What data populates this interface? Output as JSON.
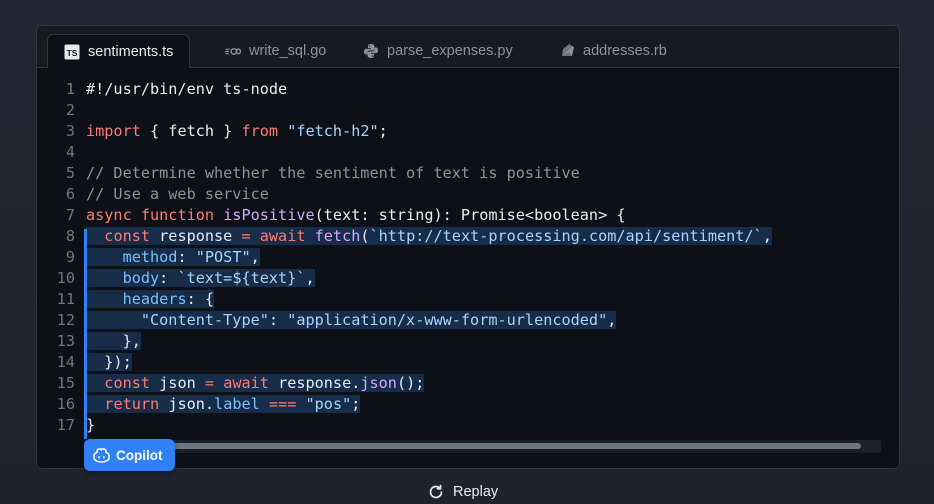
{
  "tabs": [
    {
      "label": "sentiments.ts",
      "icon": "typescript-icon",
      "active": true
    },
    {
      "label": "write_sql.go",
      "icon": "go-icon",
      "active": false
    },
    {
      "label": "parse_expenses.py",
      "icon": "python-icon",
      "active": false
    },
    {
      "label": "addresses.rb",
      "icon": "ruby-icon",
      "active": false
    }
  ],
  "code": {
    "lines": [
      {
        "n": "1",
        "hl": false,
        "tokens": [
          {
            "t": "#!/usr/bin/env ts-node",
            "c": "plain"
          }
        ]
      },
      {
        "n": "2",
        "hl": false,
        "tokens": []
      },
      {
        "n": "3",
        "hl": false,
        "tokens": [
          {
            "t": "import",
            "c": "kw"
          },
          {
            "t": " { fetch } ",
            "c": "plain"
          },
          {
            "t": "from",
            "c": "kw"
          },
          {
            "t": " ",
            "c": "plain"
          },
          {
            "t": "\"fetch-h2\"",
            "c": "str"
          },
          {
            "t": ";",
            "c": "plain"
          }
        ]
      },
      {
        "n": "4",
        "hl": false,
        "tokens": []
      },
      {
        "n": "5",
        "hl": false,
        "tokens": [
          {
            "t": "// Determine whether the sentiment of text is positive",
            "c": "com"
          }
        ]
      },
      {
        "n": "6",
        "hl": false,
        "tokens": [
          {
            "t": "// Use a web service",
            "c": "com"
          }
        ]
      },
      {
        "n": "7",
        "hl": false,
        "tokens": [
          {
            "t": "async",
            "c": "kw"
          },
          {
            "t": " ",
            "c": "plain"
          },
          {
            "t": "function",
            "c": "kw"
          },
          {
            "t": " ",
            "c": "plain"
          },
          {
            "t": "isPositive",
            "c": "fn"
          },
          {
            "t": "(text: string): Promise<boolean> {",
            "c": "plain"
          }
        ]
      },
      {
        "n": "8",
        "hl": true,
        "tokens": [
          {
            "t": "  ",
            "c": "plain"
          },
          {
            "t": "const",
            "c": "kw"
          },
          {
            "t": " response ",
            "c": "plain"
          },
          {
            "t": "=",
            "c": "kw"
          },
          {
            "t": " ",
            "c": "plain"
          },
          {
            "t": "await",
            "c": "kw"
          },
          {
            "t": " ",
            "c": "plain"
          },
          {
            "t": "fetch",
            "c": "fn"
          },
          {
            "t": "(",
            "c": "plain"
          },
          {
            "t": "`http://text-processing.com/api/sentiment/`",
            "c": "str"
          },
          {
            "t": ",",
            "c": "plain"
          }
        ]
      },
      {
        "n": "9",
        "hl": true,
        "tokens": [
          {
            "t": "    ",
            "c": "plain"
          },
          {
            "t": "method",
            "c": "prop"
          },
          {
            "t": ": ",
            "c": "plain"
          },
          {
            "t": "\"POST\"",
            "c": "str"
          },
          {
            "t": ",",
            "c": "plain"
          }
        ]
      },
      {
        "n": "10",
        "hl": true,
        "tokens": [
          {
            "t": "    ",
            "c": "plain"
          },
          {
            "t": "body",
            "c": "prop"
          },
          {
            "t": ": ",
            "c": "plain"
          },
          {
            "t": "`text=${text}`",
            "c": "str"
          },
          {
            "t": ",",
            "c": "plain"
          }
        ]
      },
      {
        "n": "11",
        "hl": true,
        "tokens": [
          {
            "t": "    ",
            "c": "plain"
          },
          {
            "t": "headers",
            "c": "prop"
          },
          {
            "t": ": {",
            "c": "plain"
          }
        ]
      },
      {
        "n": "12",
        "hl": true,
        "tokens": [
          {
            "t": "      ",
            "c": "plain"
          },
          {
            "t": "\"Content-Type\"",
            "c": "str"
          },
          {
            "t": ": ",
            "c": "plain"
          },
          {
            "t": "\"application/x-www-form-urlencoded\"",
            "c": "str"
          },
          {
            "t": ",",
            "c": "plain"
          }
        ]
      },
      {
        "n": "13",
        "hl": true,
        "tokens": [
          {
            "t": "    },",
            "c": "plain"
          }
        ]
      },
      {
        "n": "14",
        "hl": true,
        "tokens": [
          {
            "t": "  });",
            "c": "plain"
          }
        ]
      },
      {
        "n": "15",
        "hl": true,
        "tokens": [
          {
            "t": "  ",
            "c": "plain"
          },
          {
            "t": "const",
            "c": "kw"
          },
          {
            "t": " json ",
            "c": "plain"
          },
          {
            "t": "=",
            "c": "kw"
          },
          {
            "t": " ",
            "c": "plain"
          },
          {
            "t": "await",
            "c": "kw"
          },
          {
            "t": " response.",
            "c": "plain"
          },
          {
            "t": "json",
            "c": "fn"
          },
          {
            "t": "();",
            "c": "plain"
          }
        ]
      },
      {
        "n": "16",
        "hl": true,
        "tokens": [
          {
            "t": "  ",
            "c": "plain"
          },
          {
            "t": "return",
            "c": "kw"
          },
          {
            "t": " json.",
            "c": "plain"
          },
          {
            "t": "label",
            "c": "prop"
          },
          {
            "t": " ",
            "c": "plain"
          },
          {
            "t": "===",
            "c": "kw"
          },
          {
            "t": " ",
            "c": "plain"
          },
          {
            "t": "\"pos\"",
            "c": "str"
          },
          {
            "t": ";",
            "c": "plain"
          }
        ]
      },
      {
        "n": "17",
        "hl": false,
        "tokens": [
          {
            "t": "}",
            "c": "plain"
          }
        ]
      }
    ]
  },
  "copilot_badge": {
    "label": "Copilot",
    "icon": "copilot-icon"
  },
  "replay": {
    "label": "Replay",
    "icon": "replay-icon"
  },
  "colors": {
    "accent": "#2f81f7",
    "keyword": "#ff7b72",
    "string": "#a5d6ff",
    "comment": "#8b949e",
    "function": "#d2a8ff",
    "property": "#79c0ff",
    "editor_bg": "#0d1117"
  }
}
